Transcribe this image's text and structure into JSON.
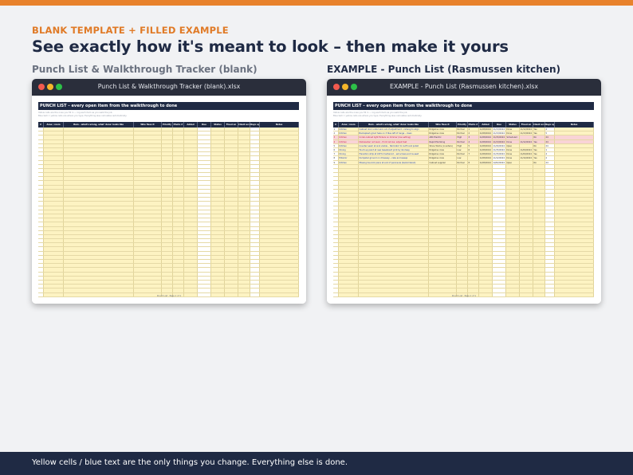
{
  "header": {
    "kicker": "BLANK TEMPLATE  +  FILLED EXAMPLE",
    "headline": "See exactly how it's meant to look – then make it yours"
  },
  "left_panel": {
    "label": "Punch List & Walkthrough Tracker (blank)",
    "window_title": "Punch List & Walkthrough Tracker (blank).xlsx",
    "sheet_title": "PUNCH LIST – every open item from the walkthrough to done",
    "note_1": "Yellow cells are the ones you fill in — log each item as you walk the job.",
    "note_2": "Blue text = yellow cells are where you type. Everything else calculates automatically.",
    "footer": "Punch List  ·  Page 1 of 1"
  },
  "right_panel": {
    "label": "EXAMPLE - Punch List (Rasmussen kitchen)",
    "window_title": "EXAMPLE - Punch List (Rasmussen kitchen).xlsx",
    "sheet_title": "PUNCH LIST – every open item from the walkthrough to done",
    "note_1": "Yellow cells are the ones you fill in — log each item as you walk the job.",
    "note_2": "Blue text = yellow cells are where you type. Everything else calculates automatically.",
    "footer": "Punch List  ·  Page 1 of 1"
  },
  "columns": [
    "#",
    "Area / room",
    "Item – what's wrong, what 'done' looks like",
    "Who fixes it",
    "Priority",
    "Photo #",
    "Added",
    "Due",
    "Status",
    "Fixed on",
    "Client accepted",
    "Days open",
    "Notes"
  ],
  "example_rows": [
    {
      "n": "1",
      "area": "Kitchen",
      "item": "Cabinet door under sink out of adjustment – rehang to align",
      "who": "Ridgeline crew",
      "pri": "Normal",
      "photo": "1",
      "added": "11/08/2024",
      "due": "11/13/2024",
      "status": "Done",
      "fixed": "11/12/2024",
      "acc": "Yes",
      "days": "4",
      "hl": ""
    },
    {
      "n": "2",
      "area": "Kitchen",
      "item": "Backsplash grout haze on 3 tiles left of range – clean",
      "who": "Ridgeline crew",
      "pri": "Normal",
      "photo": "2",
      "added": "11/08/2024",
      "due": "11/13/2024",
      "status": "Done",
      "fixed": "11/13/2024",
      "acc": "Yes",
      "days": "5",
      "hl": ""
    },
    {
      "n": "3",
      "area": "Kitchen",
      "item": "Under-cabinet light flickers on dimmer (low setting)",
      "who": "ABC Electric",
      "pri": "High",
      "photo": "3",
      "added": "11/08/2024",
      "due": "11/15/2024",
      "status": "Scheduled",
      "fixed": "",
      "acc": "No",
      "days": "24",
      "hl": "pink"
    },
    {
      "n": "4",
      "area": "Kitchen",
      "item": "Dishwasher not level – front rail low, adjust feet",
      "who": "Rapid Plumbing",
      "pri": "Normal",
      "photo": "4",
      "added": "11/08/2024",
      "due": "11/13/2024",
      "status": "Done",
      "fixed": "11/12/2024",
      "acc": "Yes",
      "days": "24",
      "hl": "pink"
    },
    {
      "n": "5",
      "area": "Kitchen",
      "item": "Counter seam at sink visible – fabricator to re-fill and polish",
      "who": "Stone Works (counters)",
      "pri": "High",
      "photo": "5",
      "added": "11/08/2024",
      "due": "11/20/2024",
      "status": "Open",
      "fixed": "",
      "acc": "No",
      "days": "24",
      "hl": ""
    },
    {
      "n": "6",
      "area": "Dining",
      "item": "Touch-up paint at new baseboard joint by doorway",
      "who": "Ridgeline crew",
      "pri": "Low",
      "photo": "6",
      "added": "11/08/2024",
      "due": "11/15/2024",
      "status": "Done",
      "fixed": "11/09/2024",
      "acc": "Yes",
      "days": "1",
      "hl": ""
    },
    {
      "n": "7",
      "area": "Dining",
      "item": "Transition strip at LVP to hardwood – set screws and re-seat",
      "who": "Ridgeline crew",
      "pri": "Normal",
      "photo": "7",
      "added": "11/08/2024",
      "due": "11/15/2024",
      "status": "Done",
      "fixed": "11/09/2024",
      "acc": "Yes",
      "days": "4",
      "hl": ""
    },
    {
      "n": "8",
      "area": "Exterior",
      "item": "Dumpster ground on driveway – rake and sweep",
      "who": "Ridgeline crew",
      "pri": "Low",
      "photo": "",
      "added": "11/08/2024",
      "due": "11/12/2024",
      "status": "Done",
      "fixed": "11/10/2024",
      "acc": "Yes",
      "days": "2",
      "hl": ""
    },
    {
      "n": "9",
      "area": "Kitchen",
      "item": "Missing toe-kick piece at end of peninsula (backordered)",
      "who": "Cabinet supplier",
      "pri": "Normal",
      "photo": "8",
      "added": "11/08/2024",
      "due": "12/02/2024",
      "status": "Open",
      "fixed": "",
      "acc": "No",
      "days": "24",
      "hl": ""
    }
  ],
  "bottom_bar": {
    "text": "Yellow cells / blue text are the only things you change. Everything else is done."
  },
  "colors": {
    "accent": "#e07a26",
    "navy": "#1f2a44",
    "fill_yellow": "#fdf3c2",
    "highlight_pink": "#f9d3d6"
  }
}
